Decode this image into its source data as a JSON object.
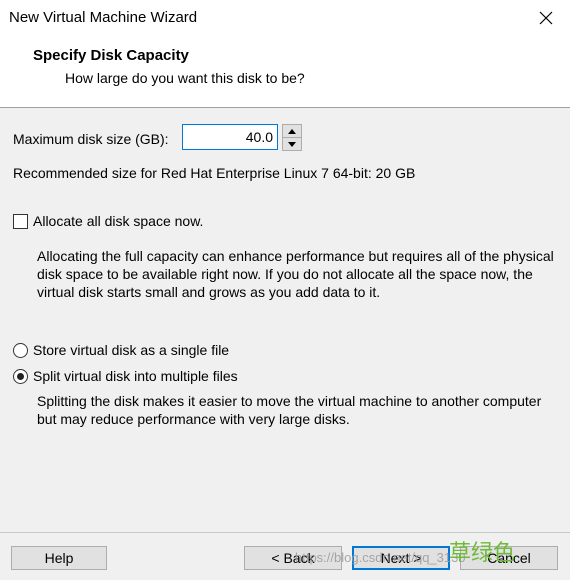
{
  "window": {
    "title": "New Virtual Machine Wizard"
  },
  "header": {
    "title": "Specify Disk Capacity",
    "subtitle": "How large do you want this disk to be?"
  },
  "disk": {
    "size_label": "Maximum disk size (GB):",
    "size_value": "40.0",
    "recommended": "Recommended size for Red Hat Enterprise Linux 7 64-bit: 20 GB"
  },
  "allocate": {
    "label": "Allocate all disk space now.",
    "checked": false,
    "description": "Allocating the full capacity can enhance performance but requires all of the physical disk space to be available right now. If you do not allocate all the space now, the virtual disk starts small and grows as you add data to it."
  },
  "storage_options": {
    "single_file_label": "Store virtual disk as a single file",
    "split_files_label": "Split virtual disk into multiple files",
    "selected": "split",
    "split_description": "Splitting the disk makes it easier to move the virtual machine to another computer but may reduce performance with very large disks."
  },
  "footer": {
    "help_label": "Help",
    "back_label": "< Back",
    "next_label": "Next >",
    "cancel_label": "Cancel"
  },
  "watermark": {
    "url_text": "https://blog.csdn.net/qq_3130",
    "cn_text": "草绿色"
  },
  "colors": {
    "accent": "#0078d7",
    "content_bg": "#f0f0f0",
    "button_bg": "#e1e1e1"
  }
}
